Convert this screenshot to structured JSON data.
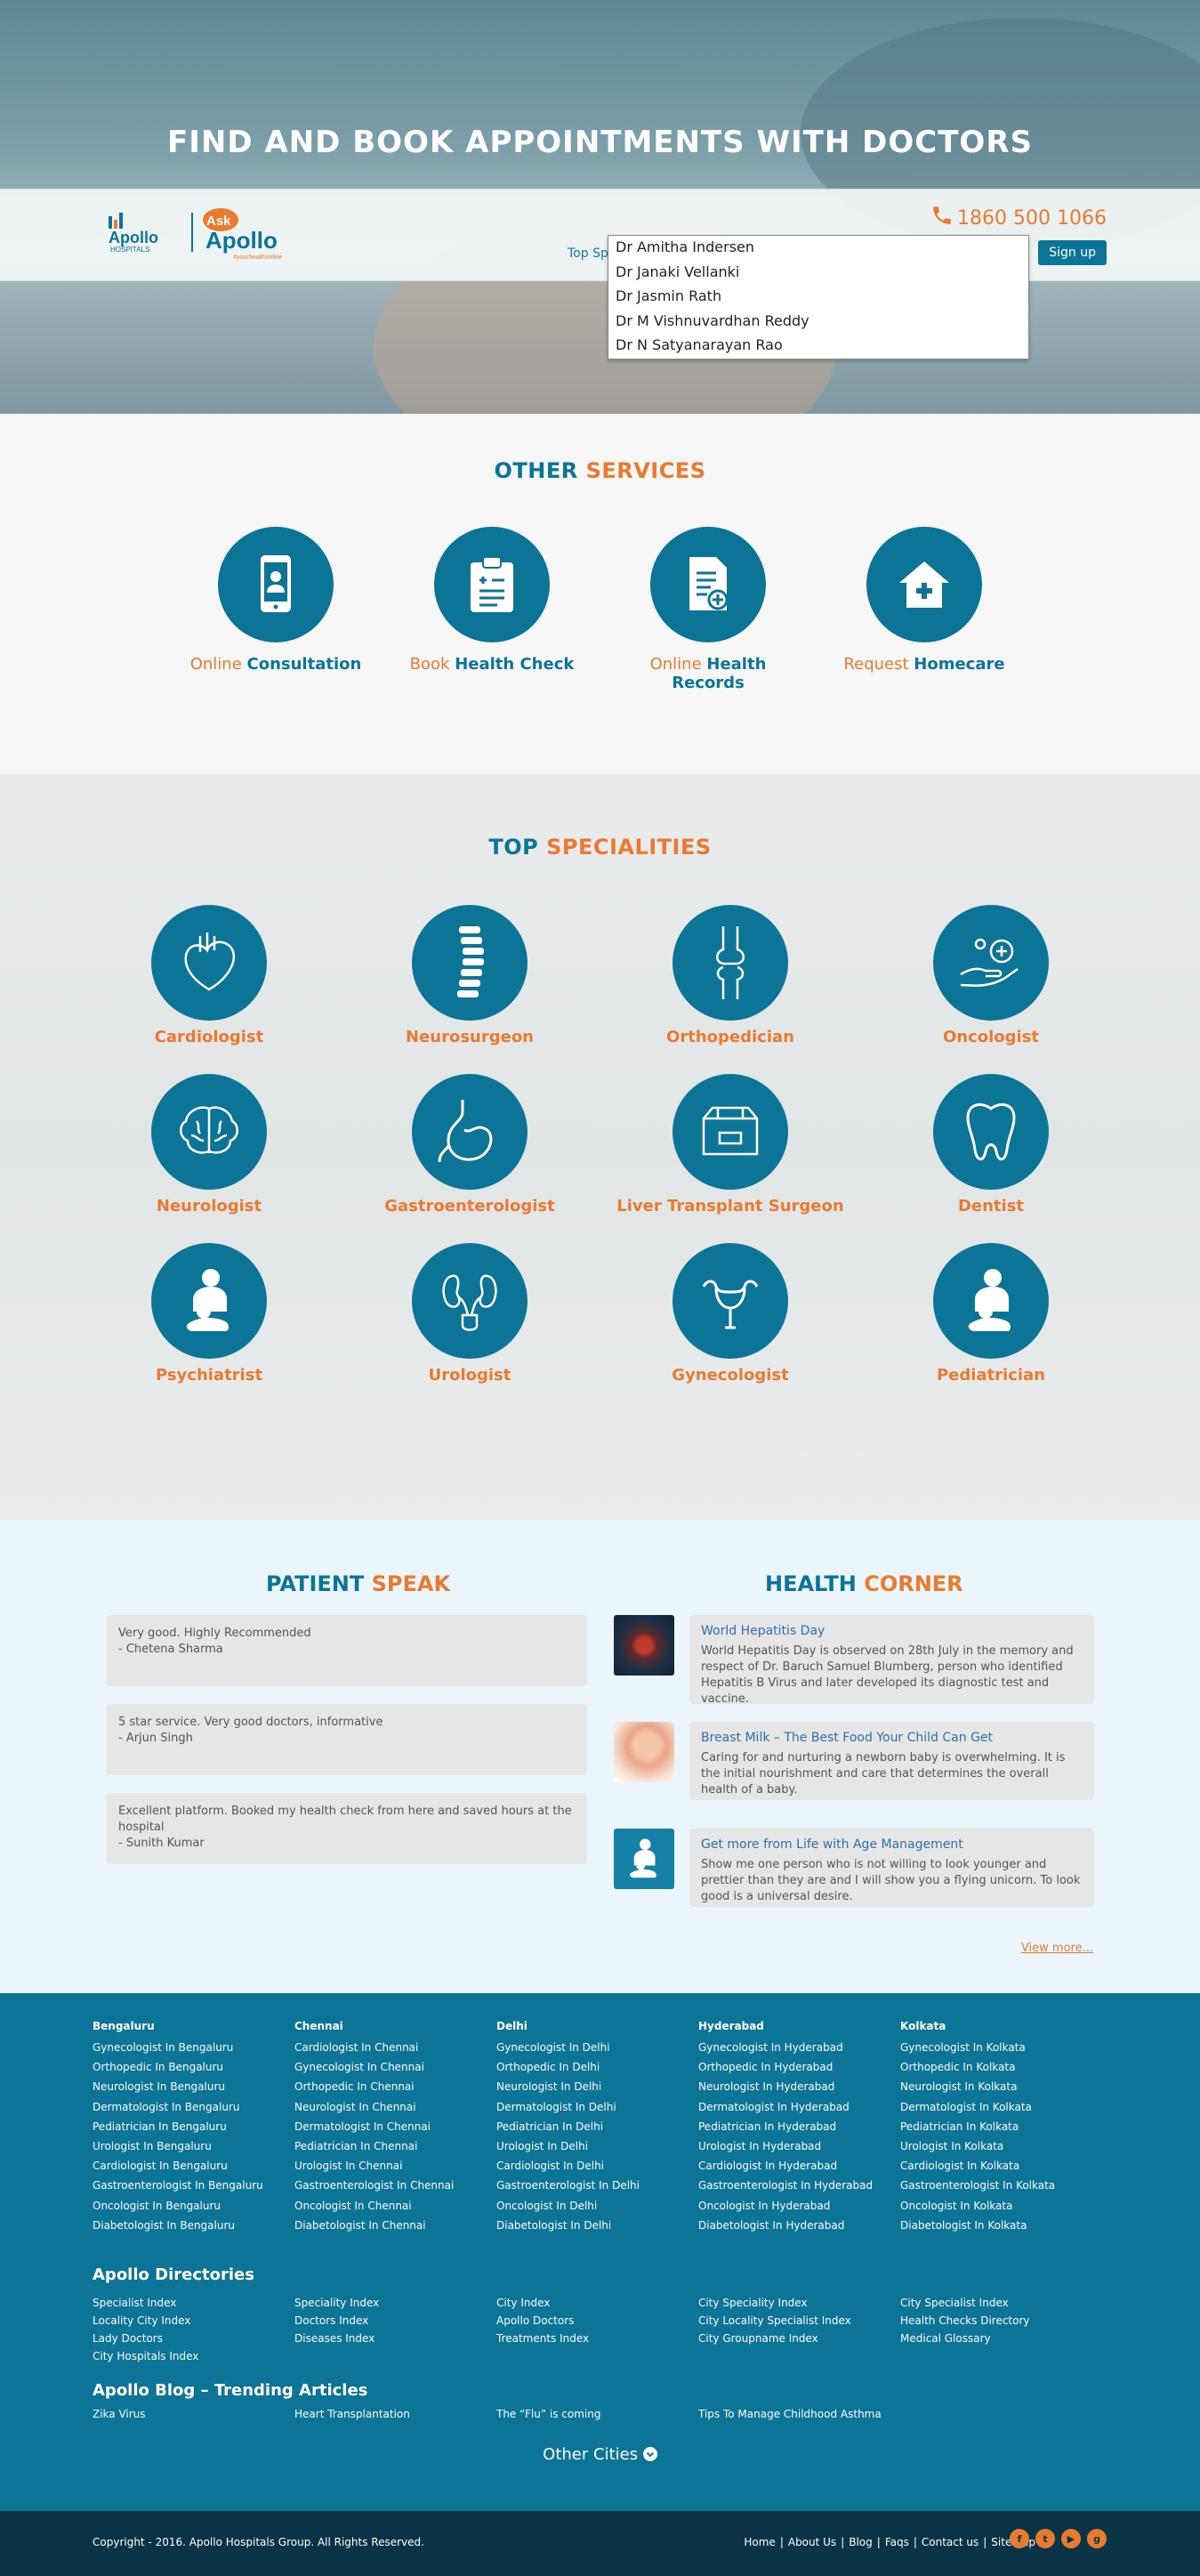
{
  "hero": {
    "title": "FIND AND BOOK APPOINTMENTS WITH DOCTORS",
    "logo": {
      "apollo": "Apollo",
      "hospitals": "HOSPITALS",
      "ask": "Ask",
      "ask_apollo": "Apollo",
      "tagline": "#yourhealthonline"
    },
    "phone": "1860 500 1066",
    "top_spec_label": "Top Sp",
    "signup_label": "Sign up",
    "suggestions": [
      "Dr Amitha Indersen",
      "Dr Janaki Vellanki",
      "Dr Jasmin Rath",
      "Dr M Vishnuvardhan Reddy",
      "Dr N Satyanarayan Rao"
    ]
  },
  "services": {
    "title_a": "OTHER",
    "title_b": "SERVICES",
    "items": [
      {
        "pre": "Online",
        "main": "Consultation",
        "icon": "mobile-doctor-icon"
      },
      {
        "pre": "Book",
        "main": "Health Check",
        "icon": "clipboard-icon"
      },
      {
        "pre": "Online",
        "main": "Health Records",
        "icon": "medical-record-icon"
      },
      {
        "pre": "Request",
        "main": "Homecare",
        "icon": "home-care-icon"
      }
    ]
  },
  "specialities": {
    "title_a": "TOP",
    "title_b": "SPECIALITIES",
    "items": [
      {
        "label": "Cardiologist",
        "icon": "heart-icon"
      },
      {
        "label": "Neurosurgeon",
        "icon": "spine-icon"
      },
      {
        "label": "Orthopedician",
        "icon": "bone-joint-icon"
      },
      {
        "label": "Oncologist",
        "icon": "cancer-care-icon"
      },
      {
        "label": "Neurologist",
        "icon": "brain-icon"
      },
      {
        "label": "Gastroenterologist",
        "icon": "stomach-icon"
      },
      {
        "label": "Liver Transplant Surgeon",
        "icon": "transplant-box-icon"
      },
      {
        "label": "Dentist",
        "icon": "tooth-icon"
      },
      {
        "label": "Psychiatrist",
        "icon": "mother-child-icon"
      },
      {
        "label": "Urologist",
        "icon": "kidney-icon"
      },
      {
        "label": "Gynecologist",
        "icon": "uterus-icon"
      },
      {
        "label": "Pediatrician",
        "icon": "mother-child-icon"
      }
    ]
  },
  "patient_speak": {
    "title_a": "PATIENT",
    "title_b": "SPEAK",
    "items": [
      {
        "quote": "Very good. Highly Recommended",
        "author": "- Chetena Sharma"
      },
      {
        "quote": "5 star service. Very good doctors, informative",
        "author": "- Arjun Singh"
      },
      {
        "quote": "Excellent platform. Booked my health check from here and saved hours at the hospital",
        "author": "- Sunith Kumar"
      }
    ]
  },
  "health_corner": {
    "title_a": "HEALTH",
    "title_b": "CORNER",
    "items": [
      {
        "title": "World Hepatitis Day",
        "text": "World Hepatitis Day is observed on 28th July in the memory and respect of Dr. Baruch Samuel Blumberg, person who identified Hepatitis B Virus and later developed its diagnostic test and vaccine.",
        "icon": "virus-thumbnail"
      },
      {
        "title": "Breast Milk – The Best Food Your Child Can Get",
        "text": "Caring for and nurturing a newborn baby is overwhelming. It is the initial nourishment and care that determines the overall health of a baby.",
        "icon": "woman-thumbnail"
      },
      {
        "title": "Get more from Life with Age Management",
        "text": "Show me one person who is not willing to look younger and prettier than they are and I will show you a flying unicorn. To look good is a universal desire.",
        "icon": "mother-child-thumbnail"
      }
    ],
    "view_more": "View more..."
  },
  "footer": {
    "cities": [
      {
        "name": "Bengaluru",
        "links": [
          "Gynecologist In Bengaluru",
          "Orthopedic In Bengaluru",
          "Neurologist In Bengaluru",
          "Dermatologist In Bengaluru",
          "Pediatrician In Bengaluru",
          "Urologist In Bengaluru",
          "Cardiologist In Bengaluru",
          "Gastroenterologist In Bengaluru",
          "Oncologist In Bengaluru",
          "Diabetologist In Bengaluru"
        ]
      },
      {
        "name": "Chennai",
        "links": [
          "Cardiologist In Chennai",
          "Gynecologist In Chennai",
          "Orthopedic In Chennai",
          "Neurologist In Chennai",
          "Dermatologist In Chennai",
          "Pediatrician In Chennai",
          "Urologist In Chennai",
          "Gastroenterologist In Chennai",
          "Oncologist In Chennai",
          "Diabetologist In Chennai"
        ]
      },
      {
        "name": "Delhi",
        "links": [
          "Gynecologist In Delhi",
          "Orthopedic In Delhi",
          "Neurologist In Delhi",
          "Dermatologist In Delhi",
          "Pediatrician In Delhi",
          "Urologist In Delhi",
          "Cardiologist In Delhi",
          "Gastroenterologist In Delhi",
          "Oncologist In Delhi",
          "Diabetologist In Delhi"
        ]
      },
      {
        "name": "Hyderabad",
        "links": [
          "Gynecologist In Hyderabad",
          "Orthopedic In Hyderabad",
          "Neurologist In Hyderabad",
          "Dermatologist In Hyderabad",
          "Pediatrician In Hyderabad",
          "Urologist In Hyderabad",
          "Cardiologist In Hyderabad",
          "Gastroenterologist In Hyderabad",
          "Oncologist In Hyderabad",
          "Diabetologist In Hyderabad"
        ]
      },
      {
        "name": "Kolkata",
        "links": [
          "Gynecologist In Kolkata",
          "Orthopedic In Kolkata",
          "Neurologist In Kolkata",
          "Dermatologist In Kolkata",
          "Pediatrician In Kolkata",
          "Urologist In Kolkata",
          "Cardiologist In Kolkata",
          "Gastroenterologist In Kolkata",
          "Oncologist In Kolkata",
          "Diabetologist In Kolkata"
        ]
      }
    ],
    "directories_title": "Apollo Directories",
    "directories": [
      [
        "Specialist Index",
        "Locality City Index",
        "Lady Doctors",
        "City Hospitals Index"
      ],
      [
        "Speciality Index",
        "Doctors Index",
        "Diseases Index"
      ],
      [
        "City Index",
        "Apollo Doctors",
        "Treatments Index"
      ],
      [
        "City Speciality Index",
        "City Locality Specialist Index",
        "City Groupname Index"
      ],
      [
        "City Specialist Index",
        "Health Checks Directory",
        "Medical Glossary"
      ]
    ],
    "blog_title": "Apollo Blog – Trending Articles",
    "blog": [
      "Zika Virus",
      "Heart Transplantation",
      "The “Flu” is coming",
      "Tips To Manage Childhood Asthma"
    ],
    "other_cities": "Other Cities"
  },
  "bottom": {
    "copyright": "Copyright - 2016. Apollo Hospitals Group. All Rights Reserved.",
    "links": [
      "Home",
      "About Us",
      "Blog",
      "Faqs",
      "Contact us",
      "Sitemap"
    ],
    "separator": "|",
    "socials": [
      "facebook-icon",
      "twitter-icon",
      "youtube-icon",
      "google-plus-icon"
    ]
  },
  "colors": {
    "primary": "#0b7497",
    "accent": "#e97a2f",
    "footer_dark": "#0a3445"
  }
}
